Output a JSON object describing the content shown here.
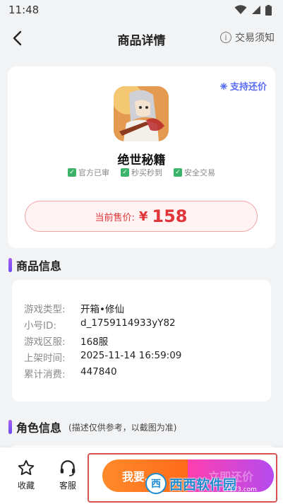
{
  "status_bar": {
    "time": "11:48"
  },
  "nav": {
    "title": "商品详情",
    "notice_label": "交易须知",
    "info_glyph": "i"
  },
  "product": {
    "bargain_tag": "支持还价",
    "name": "绝世秘籍",
    "badges": [
      "官方已审",
      "秒买秒到",
      "安全交易"
    ],
    "price_label": "当前售价:",
    "currency": "¥",
    "price": "158"
  },
  "goods_info": {
    "section_title": "商品信息",
    "rows": [
      {
        "key": "游戏类型:",
        "value": "开箱•修仙"
      },
      {
        "key": "小号ID:",
        "value": "d_1759114933yY82"
      },
      {
        "key": "游戏区服:",
        "value": "168服"
      },
      {
        "key": "上架时间:",
        "value": "2025-11-14 16:59:09"
      },
      {
        "key": "累计消费:",
        "value": "447840"
      }
    ]
  },
  "role_info": {
    "section_title": "角色信息",
    "subtitle": "(描述仅供参考，以截图为准)"
  },
  "bottom_bar": {
    "favorite_label": "收藏",
    "service_label": "客服",
    "buy_label": "我要…",
    "bargain_label": "立即还价"
  },
  "watermark": {
    "logo_text": "西",
    "text": "西西软件园",
    "url": "cr173.com"
  },
  "colors": {
    "price_red": "#e0363a",
    "accent_blue": "#5b6ef5",
    "buy_orange": "#ff7a22",
    "bargain_pink": "#ff3fae"
  }
}
